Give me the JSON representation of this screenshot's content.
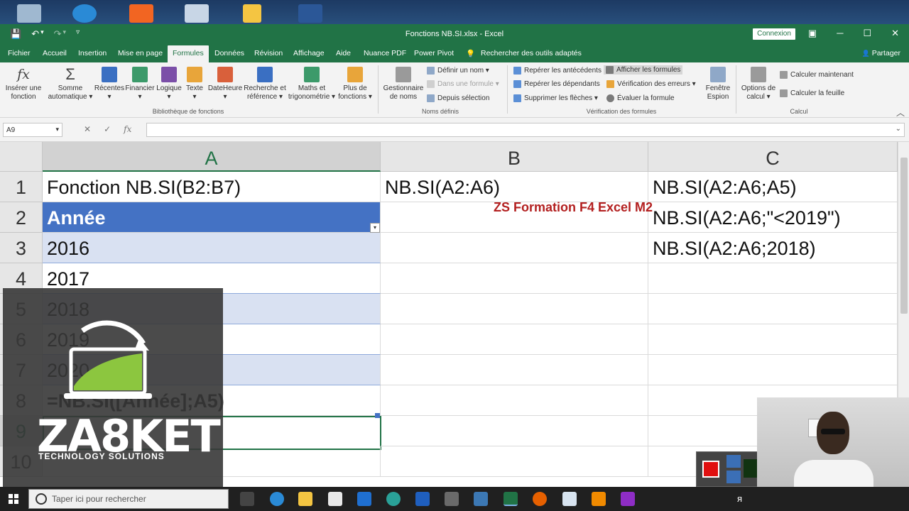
{
  "titlebar": {
    "title": "Fonctions NB.SI.xlsx  -  Excel",
    "save_icon": "💾",
    "undo_icon": "↶",
    "undo_caret": "▾",
    "redo_icon": "↷",
    "redo_caret": "▾",
    "customize_icon": "▿",
    "connexion": "Connexion",
    "ribbon_display_icon": "▣",
    "minimize_icon": "─",
    "restore_icon": "☐",
    "close_icon": "✕"
  },
  "tabs": [
    "Fichier",
    "Accueil",
    "Insertion",
    "Mise en page",
    "Formules",
    "Données",
    "Révision",
    "Affichage",
    "Aide",
    "Nuance PDF",
    "Power Pivot"
  ],
  "active_tab": "Formules",
  "tell_me": "Rechercher des outils adaptés",
  "tell_me_icon": "💡",
  "share": "Partager",
  "share_icon": "👤",
  "ribbon": {
    "insert_function": [
      "Insérer une",
      "fonction"
    ],
    "insert_function_icon": "fx",
    "autosum": [
      "Somme",
      "automatique ▾"
    ],
    "autosum_icon": "Σ",
    "recent": [
      "Récentes",
      "▾"
    ],
    "financial": [
      "Financier",
      "▾"
    ],
    "logical": [
      "Logique",
      "▾"
    ],
    "text": [
      "Texte",
      "▾"
    ],
    "datetime": [
      "DateHeure",
      "▾"
    ],
    "lookup": [
      "Recherche et",
      "référence ▾"
    ],
    "math": [
      "Maths et",
      "trigonométrie ▾"
    ],
    "more": [
      "Plus de",
      "fonctions ▾"
    ],
    "library_label": "Bibliothèque de fonctions",
    "name_manager": [
      "Gestionnaire",
      "de noms"
    ],
    "define_name": "Définir un nom  ▾",
    "use_in_formula": "Dans une formule ▾",
    "create_from_selection": "Depuis sélection",
    "names_label": "Noms définis",
    "trace_precedents": "Repérer les antécédents",
    "trace_dependents": "Repérer les dépendants",
    "remove_arrows": "Supprimer les flèches  ▾",
    "show_formulas": "Afficher les formules",
    "error_checking": "Vérification des erreurs  ▾",
    "evaluate_formula": "Évaluer la formule",
    "watch_window": [
      "Fenêtre",
      "Espion"
    ],
    "audit_label": "Vérification des formules",
    "calc_options": [
      "Options de",
      "calcul ▾"
    ],
    "calc_now": "Calculer maintenant",
    "calc_sheet": "Calculer la feuille",
    "calc_label": "Calcul",
    "collapse_icon": "︿"
  },
  "formula_bar": {
    "name_box": "A9",
    "name_box_caret": "▾",
    "cancel_icon": "✕",
    "enter_icon": "✓",
    "fx_icon": "fx",
    "expand_icon": "⌄",
    "value": ""
  },
  "columns": [
    "A",
    "B",
    "C"
  ],
  "rows": [
    "1",
    "2",
    "3",
    "4",
    "5",
    "6",
    "7",
    "8",
    "9",
    "10"
  ],
  "cells": {
    "A1": "Fonction  NB.SI(B2:B7)",
    "B1": "NB.SI(A2:A6)",
    "C1": "NB.SI(A2:A6;A5)",
    "A2": "Année",
    "C2": "NB.SI(A2:A6;\"<2019\")",
    "A3": "2016",
    "C3": "NB.SI(A2:A6;2018)",
    "A4": "2017",
    "A5": "2018",
    "A6": "2019",
    "A7": "2020",
    "A8": "=NB.SI([Année];A5)"
  },
  "watermark": "ZS Formation F4 Excel M2",
  "filter_caret": "▾",
  "logo": {
    "name": "ZA8KET",
    "tagline": "TECHNOLOGY SOLUTIONS"
  },
  "taskbar": {
    "search_placeholder": "Taper ici pour rechercher",
    "people_icon": "ᴙ"
  },
  "colors": {
    "excel_green": "#217346",
    "table_header": "#4472c4",
    "band": "#d9e1f2",
    "watermark": "#b32020"
  }
}
